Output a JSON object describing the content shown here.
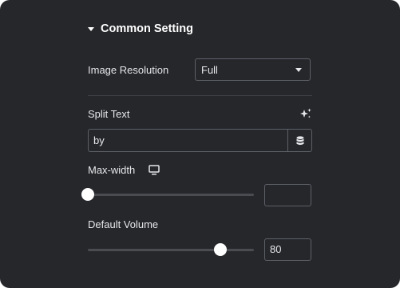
{
  "section": {
    "title": "Common Setting"
  },
  "image_resolution": {
    "label": "Image Resolution",
    "selected": "Full"
  },
  "split_text": {
    "label": "Split Text",
    "value": "by"
  },
  "max_width": {
    "label": "Max-width",
    "slider_fraction": 0.0,
    "value": ""
  },
  "default_volume": {
    "label": "Default Volume",
    "slider_fraction": 0.8,
    "value": "80"
  },
  "colors": {
    "panel_bg": "#26272b",
    "border": "#5d6067",
    "text": "#e6e7e9",
    "slider_track": "#4a4c52",
    "slider_thumb": "#ffffff"
  },
  "icons": {
    "section_toggle": "caret-down-icon",
    "select_arrow": "chevron-down-icon",
    "ai": "sparkle-icon",
    "dynamic_tags": "database-icon",
    "responsive": "desktop-monitor-icon"
  }
}
